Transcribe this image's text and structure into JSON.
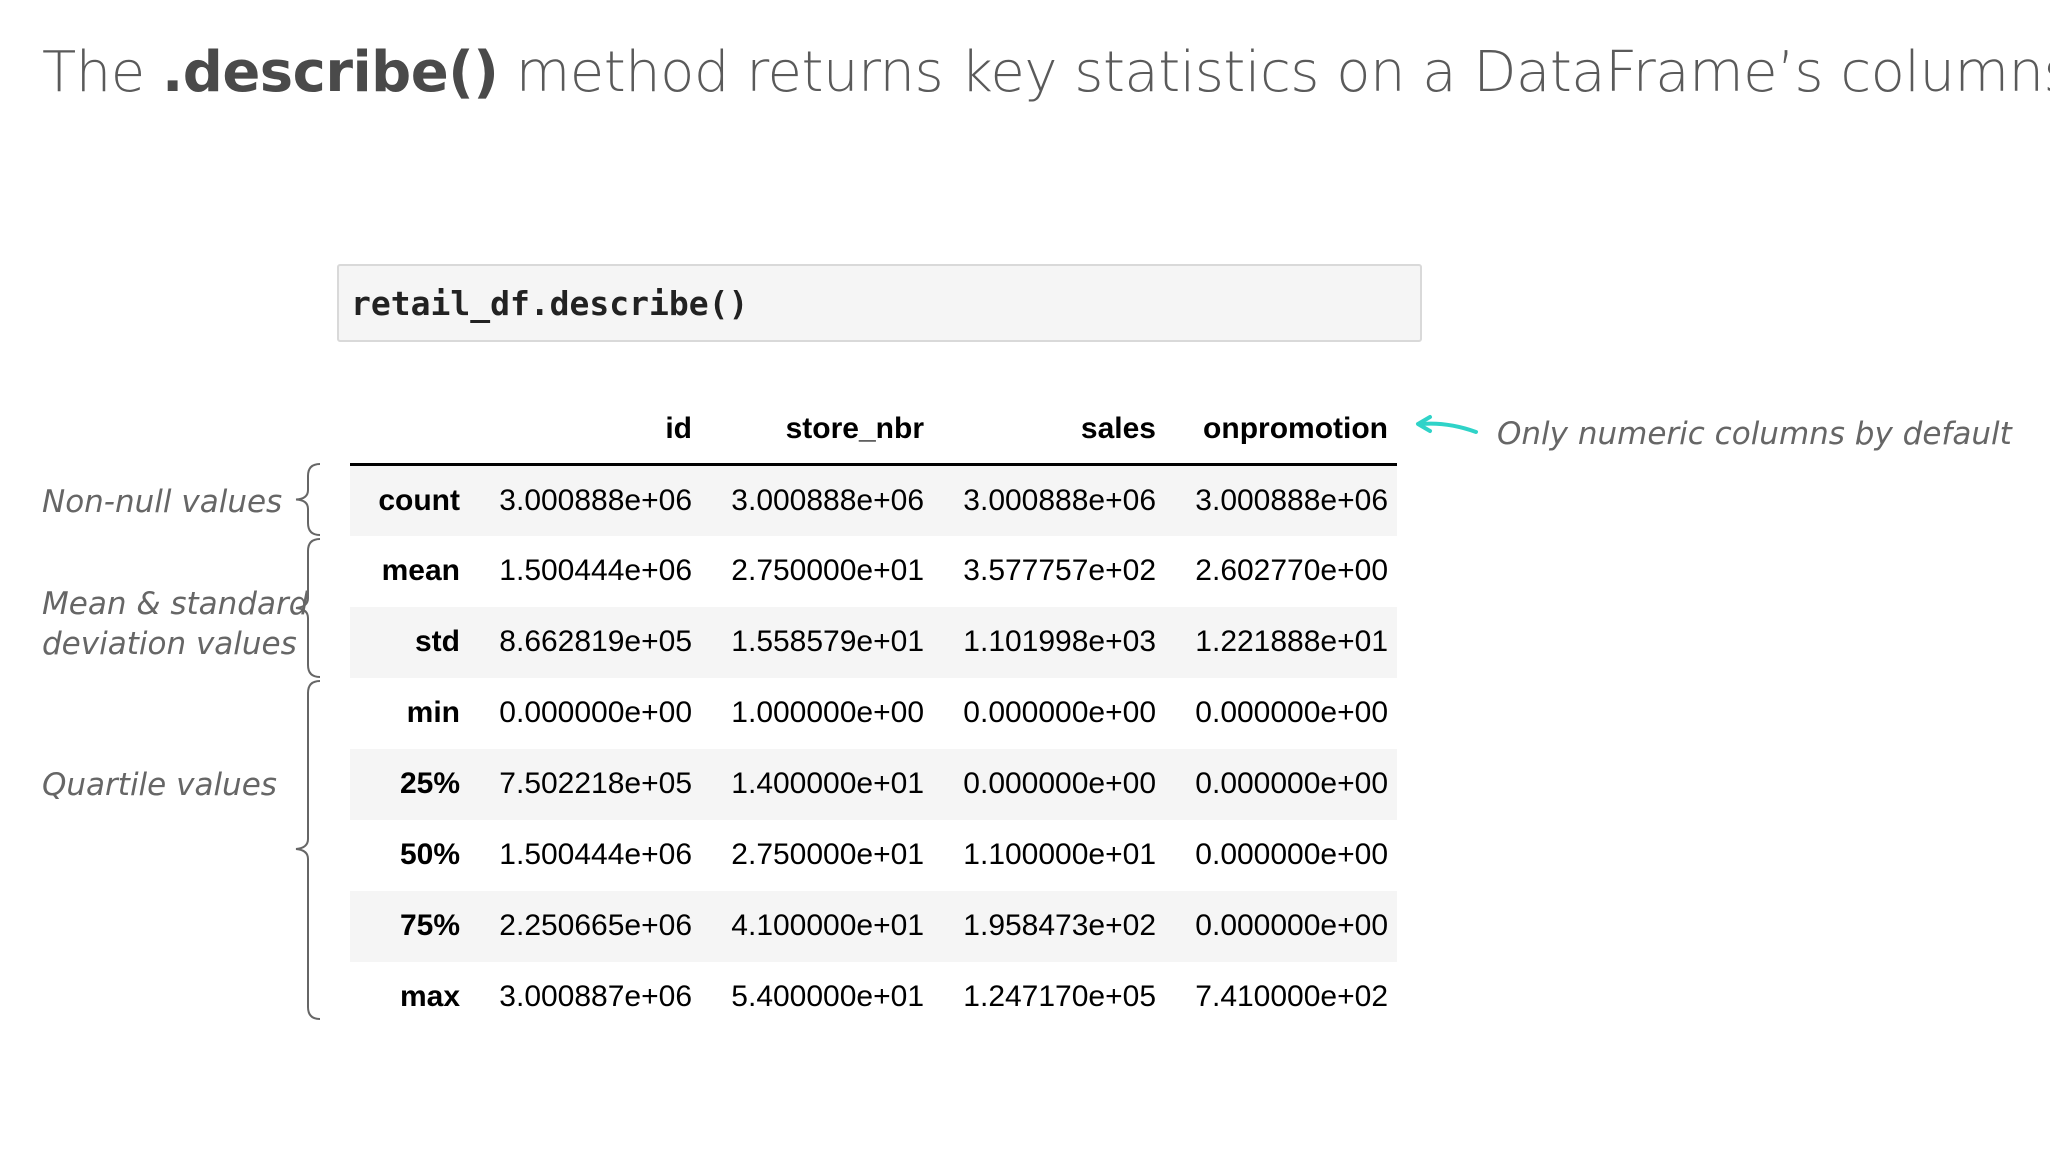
{
  "title": {
    "prefix": "The ",
    "method": ".describe()",
    "suffix": " method returns key statistics on a DataFrame’s columns"
  },
  "code": "retail_df.describe()",
  "table": {
    "columns": [
      "",
      "id",
      "store_nbr",
      "sales",
      "onpromotion"
    ],
    "rows": [
      {
        "label": "count",
        "values": [
          "3.000888e+06",
          "3.000888e+06",
          "3.000888e+06",
          "3.000888e+06"
        ]
      },
      {
        "label": "mean",
        "values": [
          "1.500444e+06",
          "2.750000e+01",
          "3.577757e+02",
          "2.602770e+00"
        ]
      },
      {
        "label": "std",
        "values": [
          "8.662819e+05",
          "1.558579e+01",
          "1.101998e+03",
          "1.221888e+01"
        ]
      },
      {
        "label": "min",
        "values": [
          "0.000000e+00",
          "1.000000e+00",
          "0.000000e+00",
          "0.000000e+00"
        ]
      },
      {
        "label": "25%",
        "values": [
          "7.502218e+05",
          "1.400000e+01",
          "0.000000e+00",
          "0.000000e+00"
        ]
      },
      {
        "label": "50%",
        "values": [
          "1.500444e+06",
          "2.750000e+01",
          "1.100000e+01",
          "0.000000e+00"
        ]
      },
      {
        "label": "75%",
        "values": [
          "2.250665e+06",
          "4.100000e+01",
          "1.958473e+02",
          "0.000000e+00"
        ]
      },
      {
        "label": "max",
        "values": [
          "3.000887e+06",
          "5.400000e+01",
          "1.247170e+05",
          "7.410000e+02"
        ]
      }
    ]
  },
  "annotations": {
    "non_null": "Non-null values",
    "mean_std_line1": "Mean & standard",
    "mean_std_line2": "deviation values",
    "quartile": "Quartile values",
    "numeric_note": "Only numeric columns by default"
  },
  "colors": {
    "arrow": "#2fd3c8",
    "stripe": "#f5f5f5",
    "annotation_text": "#666666"
  }
}
